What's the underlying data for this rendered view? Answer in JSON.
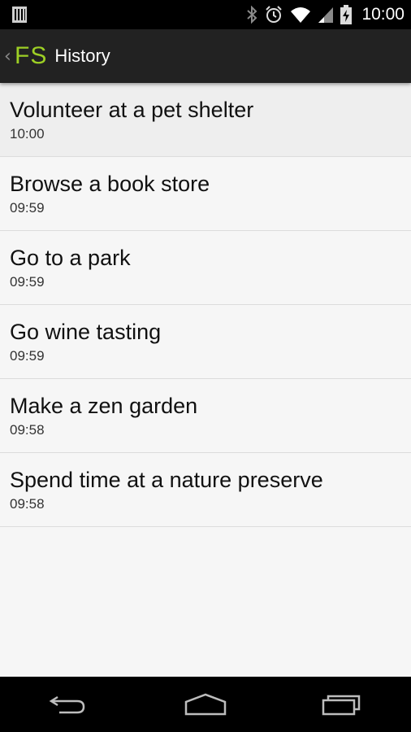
{
  "status_bar": {
    "time": "10:00",
    "icons": [
      "sim-icon",
      "bluetooth-icon",
      "alarm-icon",
      "wifi-icon",
      "signal-icon",
      "battery-charging-icon"
    ]
  },
  "action_bar": {
    "up_caret": "‹",
    "logo": "FS",
    "title": "History",
    "logo_color": "#9dcf25"
  },
  "history": {
    "items": [
      {
        "title": "Volunteer at a pet shelter",
        "time": "10:00"
      },
      {
        "title": "Browse a book store",
        "time": "09:59"
      },
      {
        "title": "Go to a park",
        "time": "09:59"
      },
      {
        "title": "Go wine tasting",
        "time": "09:59"
      },
      {
        "title": "Make a zen garden",
        "time": "09:58"
      },
      {
        "title": "Spend time at a nature preserve",
        "time": "09:58"
      }
    ]
  },
  "nav_bar": {
    "icons": [
      "back-icon",
      "home-icon",
      "recents-icon"
    ]
  }
}
